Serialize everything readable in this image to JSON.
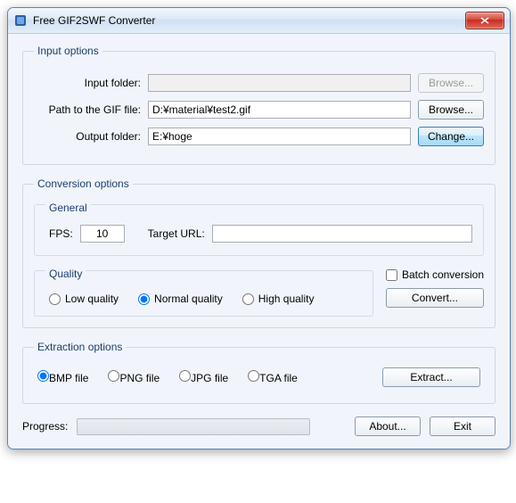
{
  "window": {
    "title": "Free GIF2SWF Converter"
  },
  "input_options": {
    "legend": "Input options",
    "input_folder_label": "Input folder:",
    "input_folder_value": "",
    "input_folder_browse": "Browse...",
    "gif_path_label": "Path to the GIF file:",
    "gif_path_value": "D:¥material¥test2.gif",
    "gif_path_browse": "Browse...",
    "output_folder_label": "Output folder:",
    "output_folder_value": "E:¥hoge",
    "output_folder_change": "Change..."
  },
  "conversion": {
    "legend": "Conversion options",
    "general_title": "General",
    "fps_label": "FPS:",
    "fps_value": "10",
    "target_url_label": "Target URL:",
    "target_url_value": "",
    "quality_title": "Quality",
    "quality_low": "Low quality",
    "quality_normal": "Normal quality",
    "quality_high": "High quality",
    "quality_selected": "normal",
    "batch_label": "Batch conversion",
    "batch_checked": false,
    "convert_btn": "Convert..."
  },
  "extraction": {
    "legend": "Extraction options",
    "bmp": "BMP file",
    "png": "PNG file",
    "jpg": "JPG file",
    "tga": "TGA file",
    "selected": "bmp",
    "extract_btn": "Extract..."
  },
  "footer": {
    "progress_label": "Progress:",
    "about_btn": "About...",
    "exit_btn": "Exit"
  }
}
